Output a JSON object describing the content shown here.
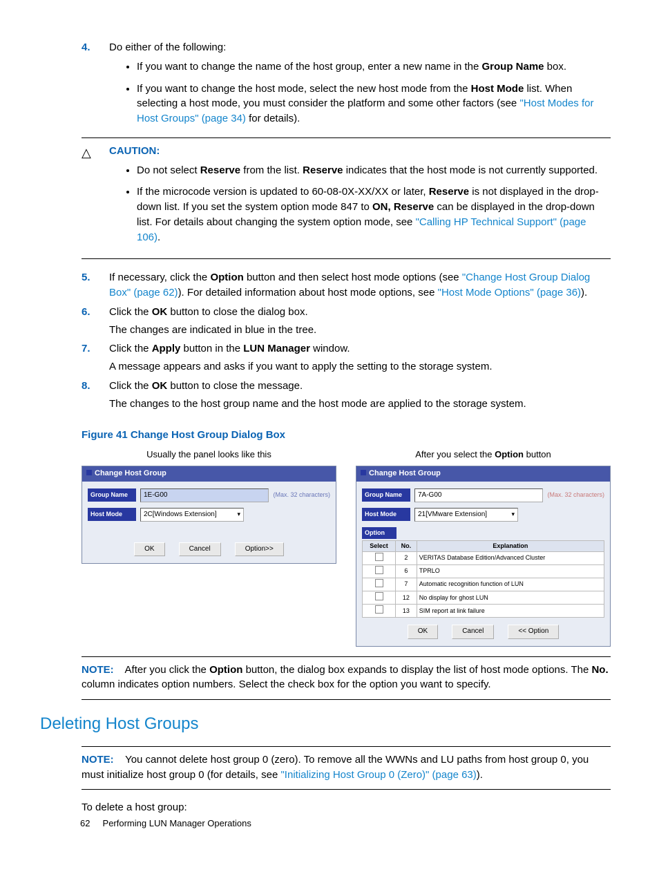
{
  "steps": {
    "s4": {
      "num": "4.",
      "text": "Do either of the following:",
      "b1_a": "If you want to change the name of the host group, enter a new name in the ",
      "b1_bold": "Group Name",
      "b1_b": " box.",
      "b2_a": "If you want to change the host mode, select the new host mode from the ",
      "b2_bold": "Host Mode",
      "b2_b": " list. When selecting a host mode, you must consider the platform and some other factors (see ",
      "b2_link": "\"Host Modes for Host Groups\" (page 34)",
      "b2_c": " for details)."
    },
    "s5": {
      "num": "5.",
      "a": "If necessary, click the ",
      "b1": "Option",
      "b": " button and then select host mode options (see ",
      "link1": "\"Change Host Group Dialog Box\" (page 62)",
      "c": "). For detailed information about host mode options, see ",
      "link2": "\"Host Mode Options\" (page 36)",
      "d": ")."
    },
    "s6": {
      "num": "6.",
      "a": "Click the ",
      "b1": "OK",
      "b": " button to close the dialog box.",
      "p2": "The changes are indicated in blue in the tree."
    },
    "s7": {
      "num": "7.",
      "a": "Click the ",
      "b1": "Apply",
      "b": " button in the ",
      "b2": "LUN Manager",
      "c": " window.",
      "p2": "A message appears and asks if you want to apply the setting to the storage system."
    },
    "s8": {
      "num": "8.",
      "a": "Click the ",
      "b1": "OK",
      "b": " button to close the message.",
      "p2": "The changes to the host group name and the host mode are applied to the storage system."
    }
  },
  "caution": {
    "head": "CAUTION:",
    "b1_a": "Do not select ",
    "b1_bold1": "Reserve",
    "b1_b": " from the list. ",
    "b1_bold2": "Reserve",
    "b1_c": " indicates that the host mode is not currently supported.",
    "b2_a": "If the microcode version is updated to 60-08-0X-XX/XX or later, ",
    "b2_bold1": "Reserve",
    "b2_b": " is not displayed in the drop-down list. If you set the system option mode 847 to ",
    "b2_bold2": "ON, Reserve",
    "b2_c": " can be displayed in the drop-down list. For details about changing the system option mode, see ",
    "b2_link": "\"Calling HP Technical Support\" (page 106)",
    "b2_d": "."
  },
  "figure": {
    "caption": "Figure 41 Change Host Group Dialog Box",
    "left_label_a": "Usually the panel looks like this",
    "right_label_a": "After you select the ",
    "right_label_bold": "Option",
    "right_label_b": " button",
    "dlg_title": "Change Host Group",
    "lbl_group": "Group Name",
    "lbl_host": "Host Mode",
    "lbl_option": "Option",
    "left_group_val": "1E-G00",
    "left_hint": "(Max. 32 characters)",
    "left_host_val": "2C[Windows Extension]",
    "right_group_val": "7A-G00",
    "right_hint": "(Max. 32 characters)",
    "right_host_val": "21[VMware Extension]",
    "btn_ok": "OK",
    "btn_cancel": "Cancel",
    "btn_option": "Option>>",
    "btn_option_back": "<< Option",
    "th_select": "Select",
    "th_no": "No.",
    "th_exp": "Explanation",
    "rows": [
      {
        "no": "2",
        "exp": "VERITAS Database Edition/Advanced Cluster"
      },
      {
        "no": "6",
        "exp": "TPRLO"
      },
      {
        "no": "7",
        "exp": "Automatic recognition function of LUN"
      },
      {
        "no": "12",
        "exp": "No display for ghost LUN"
      },
      {
        "no": "13",
        "exp": "SIM report at link failure"
      }
    ]
  },
  "note1": {
    "head": "NOTE:",
    "a": "After you click the ",
    "bold1": "Option",
    "b": " button, the dialog box expands to display the list of host mode options. The ",
    "bold2": "No.",
    "c": " column indicates option numbers. Select the check box for the option you want to specify."
  },
  "section": "Deleting Host Groups",
  "note2": {
    "head": "NOTE:",
    "a": "You cannot delete host group 0 (zero). To remove all the WWNs and LU paths from host group 0, you must initialize host group 0 (for details, see ",
    "link": "\"Initializing Host Group 0 (Zero)\" (page 63)",
    "b": ")."
  },
  "tail": "To delete a host group:",
  "footer": {
    "page": "62",
    "title": "Performing LUN Manager Operations"
  }
}
